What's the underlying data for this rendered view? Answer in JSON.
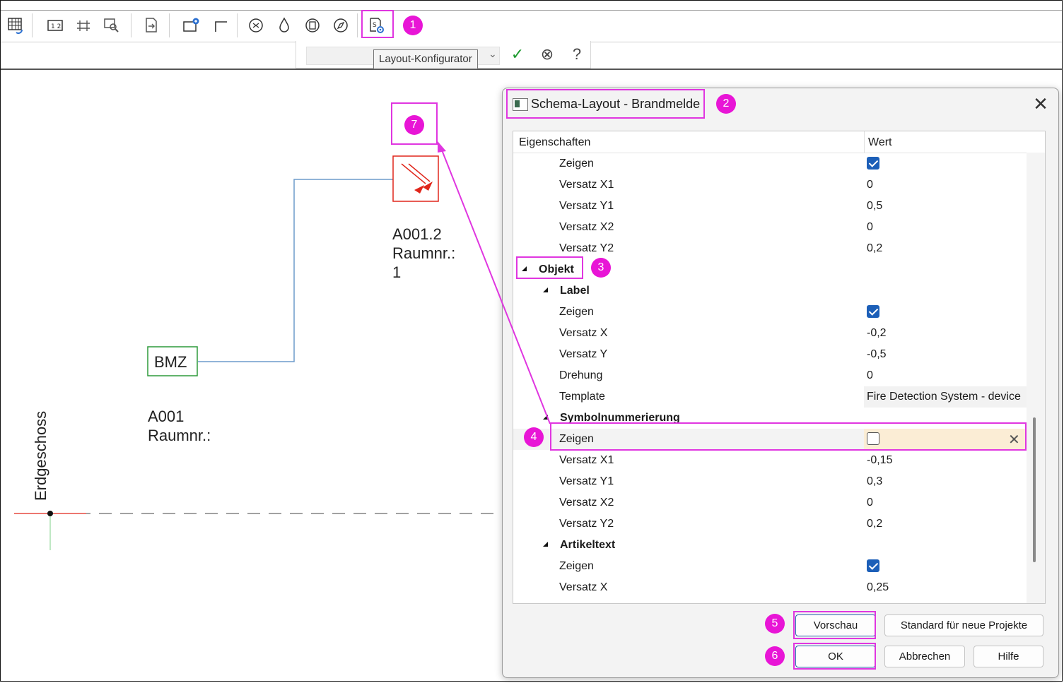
{
  "tooltip": "Layout-Konfigurator",
  "toolbar": {
    "icons": [
      "grid-refresh-icon",
      "number-table-icon",
      "dimension-icon",
      "search-settings-icon",
      "document-export-icon",
      "window-add-icon",
      "corner-icon",
      "fan-icon",
      "drop-icon",
      "box-settings-icon",
      "compass-icon",
      "layout-configurator-icon"
    ]
  },
  "options_bar": {
    "confirm_symbol": "✓",
    "cancel_symbol": "⊗",
    "help_symbol": "?"
  },
  "badges": [
    "1",
    "2",
    "3",
    "4",
    "5",
    "6",
    "7"
  ],
  "drawing": {
    "device_label": "A001.2\nRaumnr.:\n1",
    "bmz_label": "BMZ",
    "bmz_room": "A001\nRaumnr.:",
    "floor_label": "Erdgeschoss"
  },
  "dialog": {
    "title": "Schema-Layout - Brandmelde",
    "close_symbol": "✕",
    "col_property": "Eigenschaften",
    "col_value": "Wert",
    "rows": [
      {
        "label": "Zeigen",
        "type": "check",
        "checked": true
      },
      {
        "label": "Versatz X1",
        "value": "0"
      },
      {
        "label": "Versatz Y1",
        "value": "0,5"
      },
      {
        "label": "Versatz X2",
        "value": "0"
      },
      {
        "label": "Versatz Y2",
        "value": "0,2"
      },
      {
        "label": "Objekt",
        "type": "group",
        "level": 0
      },
      {
        "label": "Label",
        "type": "group",
        "level": 1
      },
      {
        "label": "Zeigen",
        "type": "check",
        "checked": true
      },
      {
        "label": "Versatz X",
        "value": "-0,2"
      },
      {
        "label": "Versatz Y",
        "value": "-0,5"
      },
      {
        "label": "Drehung",
        "value": "0"
      },
      {
        "label": "Template",
        "value": "Fire Detection System - device",
        "shaded": true
      },
      {
        "label": "Symbolnummerierung",
        "type": "group",
        "level": 1
      },
      {
        "label": "Zeigen",
        "type": "check",
        "checked": false,
        "selected": true
      },
      {
        "label": "Versatz X1",
        "value": "-0,15"
      },
      {
        "label": "Versatz Y1",
        "value": "0,3"
      },
      {
        "label": "Versatz X2",
        "value": "0"
      },
      {
        "label": "Versatz Y2",
        "value": "0,2"
      },
      {
        "label": "Artikeltext",
        "type": "group",
        "level": 1
      },
      {
        "label": "Zeigen",
        "type": "check",
        "checked": true
      },
      {
        "label": "Versatz X",
        "value": "0,25"
      }
    ],
    "buttons": {
      "preview": "Vorschau",
      "default_new": "Standard für neue Projekte",
      "ok": "OK",
      "cancel": "Abbrechen",
      "help": "Hilfe"
    }
  },
  "colors": {
    "annotation": "#e815d6",
    "checkbox": "#1c5fb8",
    "selected_row": "#fbedd5",
    "device_red": "#e0261b",
    "bmz_green": "#2d9a3a",
    "wire_blue": "#6d9ccc"
  }
}
